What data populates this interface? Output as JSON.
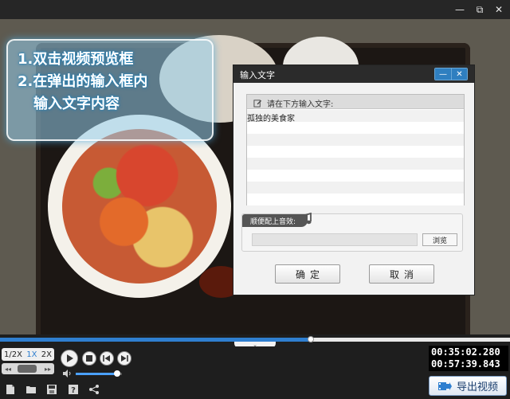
{
  "window": {
    "minimize_glyph": "—",
    "restore_glyph": "⧉",
    "close_glyph": "✕"
  },
  "hint": {
    "line1": "1.双击视频预览框",
    "line2": "2.在弹出的输入框内",
    "line3": "输入文字内容"
  },
  "dialog": {
    "title": "输入文字",
    "minimize_glyph": "—",
    "close_glyph": "✕",
    "text_section_label": "请在下方输入文字:",
    "text_value": "孤独的美食家",
    "audio_section_label": "顺便配上音效:",
    "audio_path_value": "",
    "browse_label": "浏览",
    "ok_label": "确定",
    "cancel_label": "取消"
  },
  "player": {
    "progress": 0.61,
    "speed_half": "1/2X",
    "speed_normal": "1X",
    "speed_double": "2X",
    "speed_slow_glyph": "◂◂",
    "speed_fast_glyph": "▸▸",
    "volume": 0.9,
    "current_time": "00:35:02.280",
    "total_time": "00:57:39.843",
    "collapse_glyph": "⌄"
  },
  "toolbar": {
    "export_label": "导出视频"
  },
  "colors": {
    "accent": "#2f7fd0",
    "dialog_title": "#2b2b2b",
    "hint_glow": "#50aadc"
  },
  "icons": {
    "play": "play-icon",
    "stop": "stop-icon",
    "prev": "prev-frame-icon",
    "next": "next-frame-icon",
    "volume": "volume-icon",
    "new": "new-file-icon",
    "open": "open-folder-icon",
    "save": "save-icon",
    "help": "help-icon",
    "share": "share-icon",
    "export": "export-video-icon",
    "edit": "edit-icon",
    "note": "music-note-icon"
  }
}
